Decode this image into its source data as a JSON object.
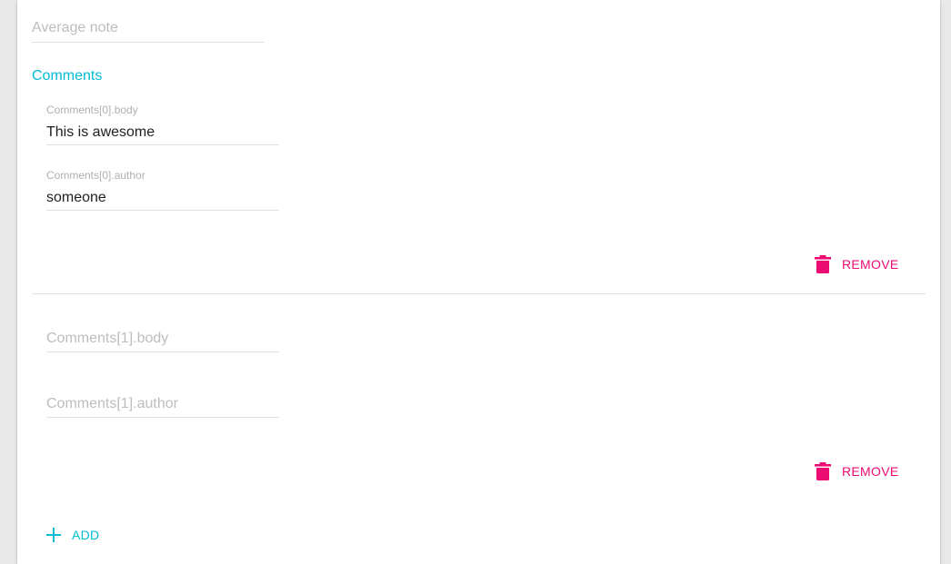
{
  "form": {
    "average_note": {
      "placeholder": "Average note",
      "value": ""
    },
    "comments_title": "Comments",
    "comments": [
      {
        "body": {
          "label": "Comments[0].body",
          "value": "This is awesome"
        },
        "author": {
          "label": "Comments[0].author",
          "value": "someone"
        },
        "remove_label": "REMOVE"
      },
      {
        "body": {
          "placeholder": "Comments[1].body",
          "value": ""
        },
        "author": {
          "placeholder": "Comments[1].author",
          "value": ""
        },
        "remove_label": "REMOVE"
      }
    ],
    "add_label": "ADD"
  },
  "colors": {
    "accent": "#00bcd4",
    "danger": "#ec0b73",
    "text": "#212121",
    "placeholder": "#bdbdbd"
  },
  "icons": {
    "remove": "trash-icon",
    "add": "plus-icon"
  }
}
